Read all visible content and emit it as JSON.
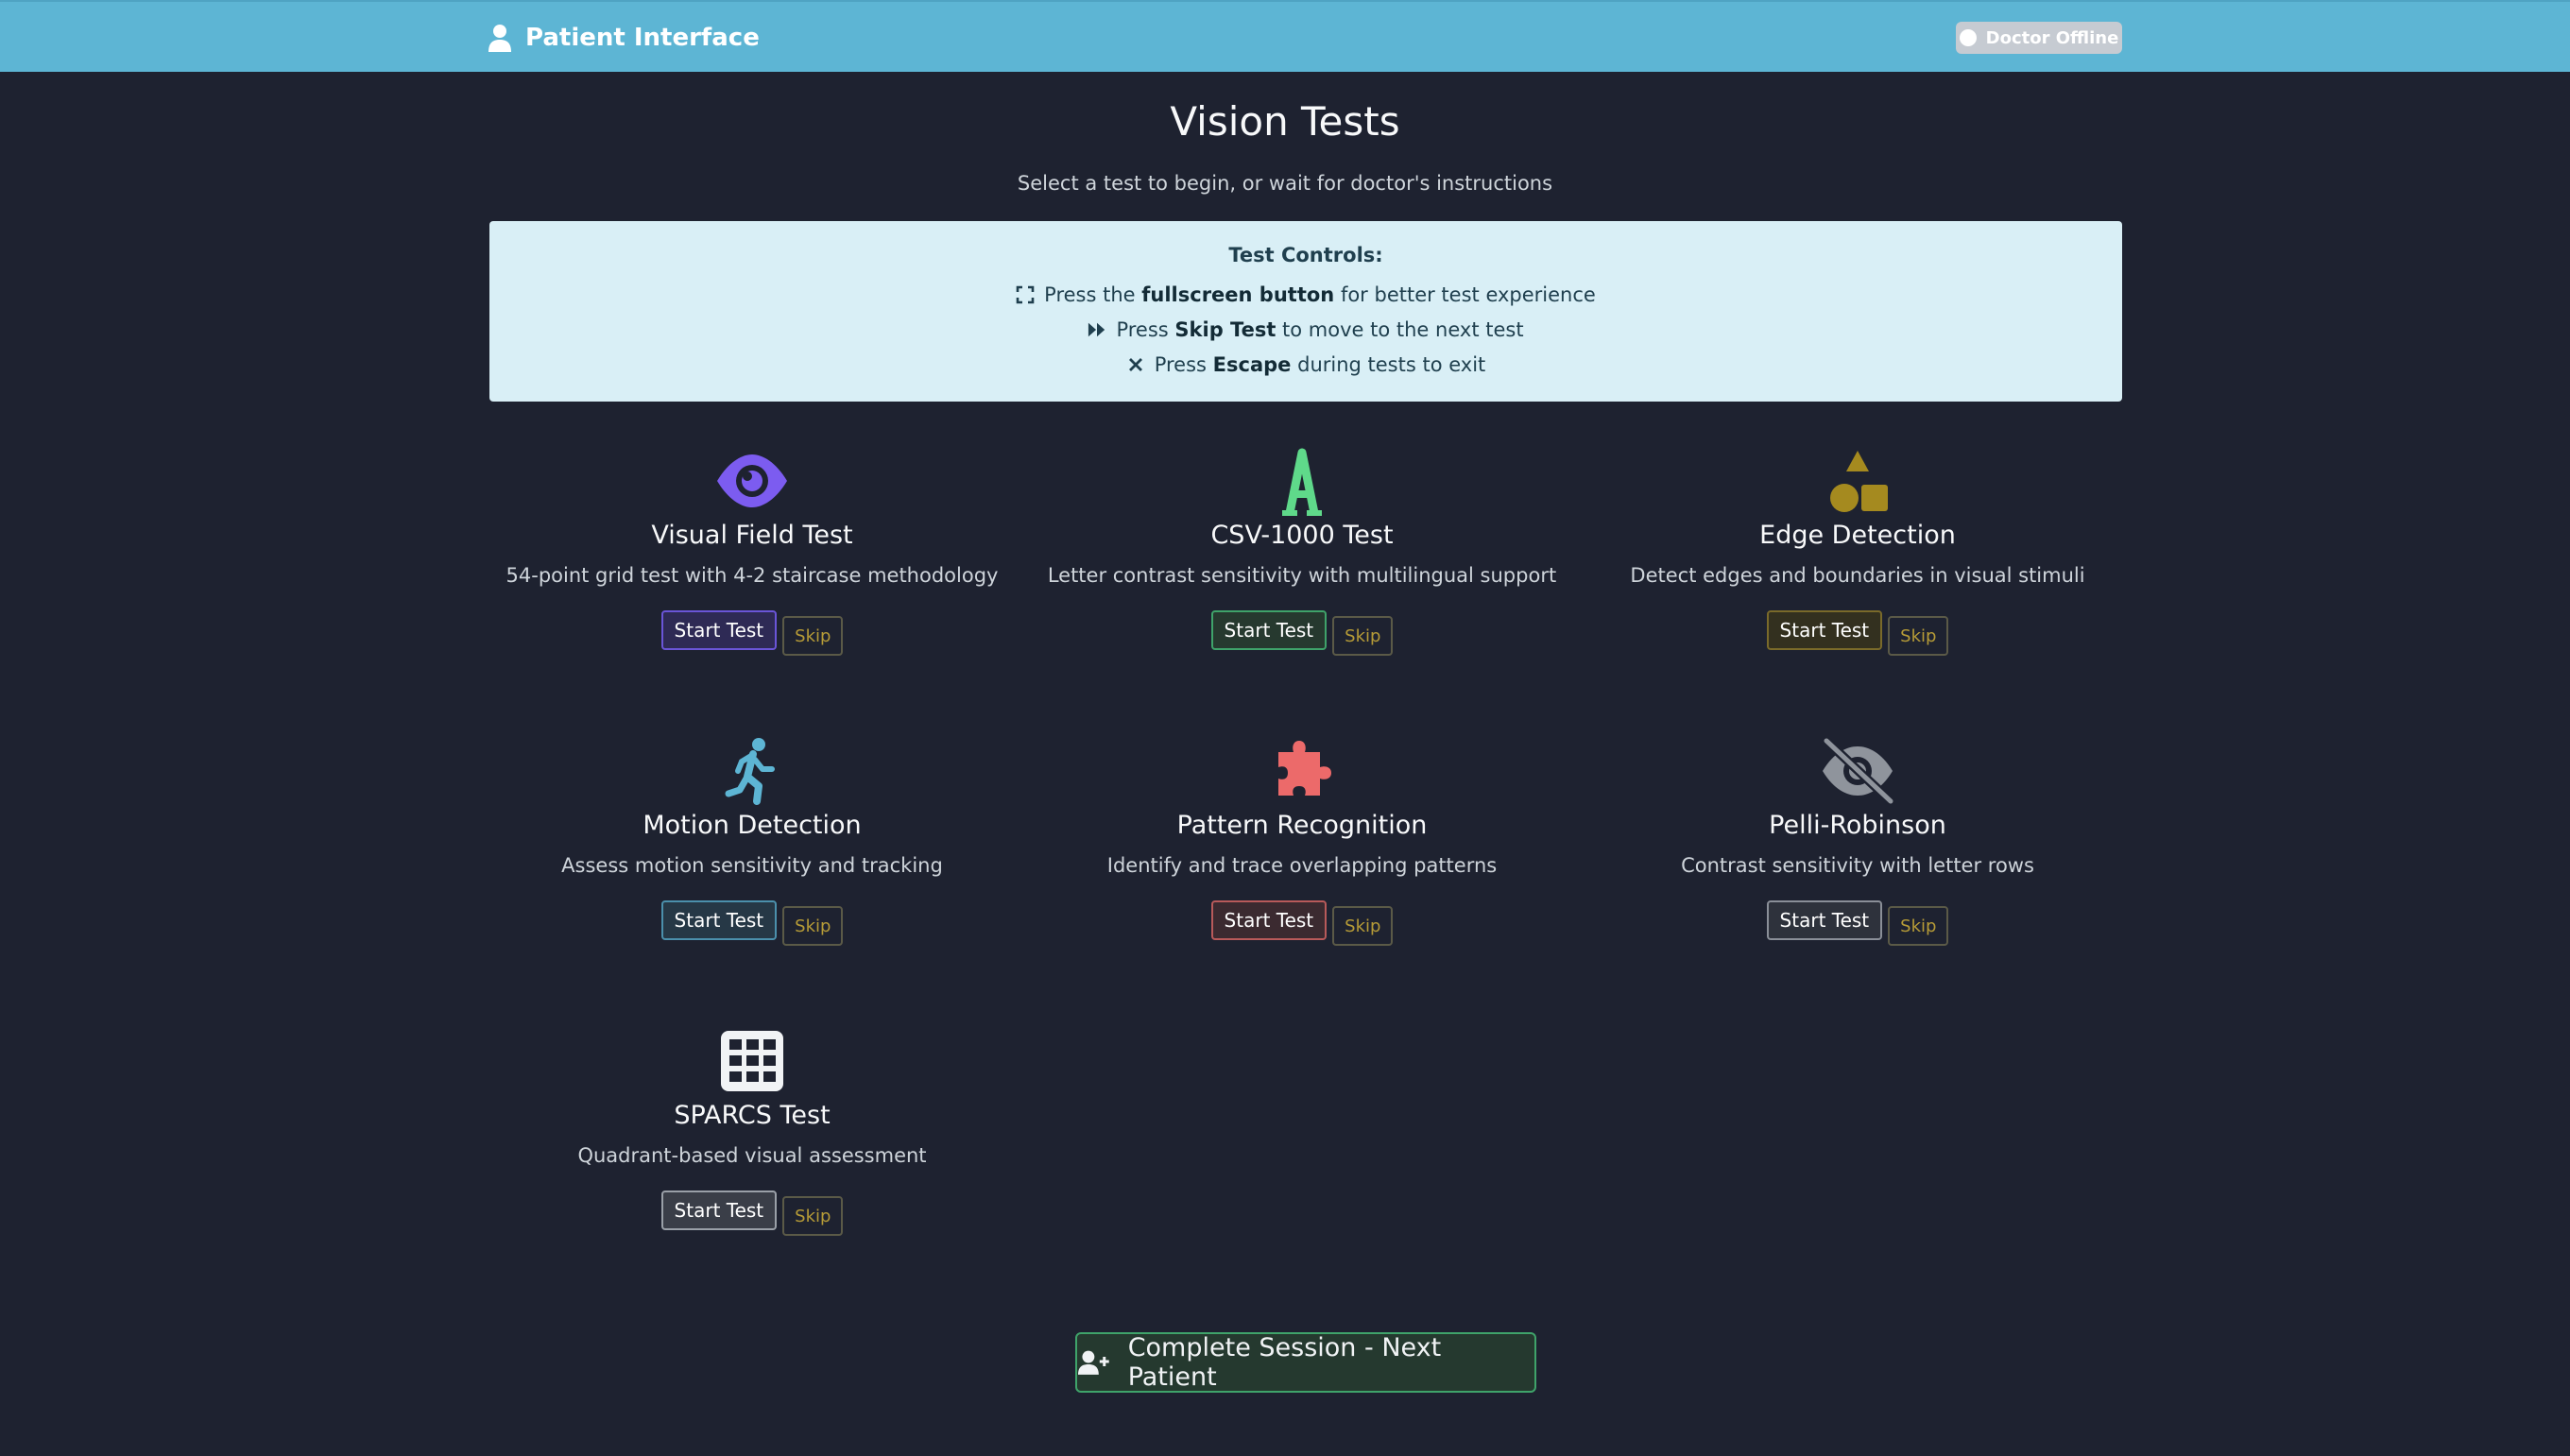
{
  "navbar": {
    "brand": "Patient Interface",
    "brand_icon": "user-icon",
    "status": "Doctor Offline"
  },
  "header": {
    "title": "Vision Tests",
    "subtitle": "Select a test to begin, or wait for doctor's instructions"
  },
  "controls": {
    "title": "Test Controls:",
    "lines": [
      {
        "icon": "expand-icon",
        "pre": "Press the",
        "bold": "fullscreen button",
        "post": "for better test experience"
      },
      {
        "icon": "fast-forward-icon",
        "pre": "Press",
        "bold": "Skip Test",
        "post": "to move to the next test"
      },
      {
        "icon": "close-icon",
        "pre": "Press",
        "bold": "Escape",
        "post": "during tests to exit"
      }
    ]
  },
  "tests": [
    {
      "title": "Visual Field Test",
      "desc": "54-point grid test with 4-2 staircase methodology",
      "start": "Start Test",
      "skip": "Skip",
      "icon": "eye-icon",
      "color": "#7c5cf0",
      "btn_bg": "#2e2a55",
      "btn_border": "#6a55d8"
    },
    {
      "title": "CSV-1000 Test",
      "desc": "Letter contrast sensitivity with multilingual support",
      "start": "Start Test",
      "skip": "Skip",
      "icon": "letter-a-icon",
      "color": "#5fd98a",
      "btn_bg": "#26392f",
      "btn_border": "#3fa36a"
    },
    {
      "title": "Edge Detection",
      "desc": "Detect edges and boundaries in visual stimuli",
      "start": "Start Test",
      "skip": "Skip",
      "icon": "shapes-icon",
      "color": "#a58a1f",
      "btn_bg": "#33301f",
      "btn_border": "#7a6a2a"
    },
    {
      "title": "Motion Detection",
      "desc": "Assess motion sensitivity and tracking",
      "start": "Start Test",
      "skip": "Skip",
      "icon": "running-person-icon",
      "color": "#5db5d4",
      "btn_bg": "#263846",
      "btn_border": "#4b90ac"
    },
    {
      "title": "Pattern Recognition",
      "desc": "Identify and trace overlapping patterns",
      "start": "Start Test",
      "skip": "Skip",
      "icon": "puzzle-icon",
      "color": "#ec6a6a",
      "btn_bg": "#3b2a30",
      "btn_border": "#b85a5a"
    },
    {
      "title": "Pelli-Robinson",
      "desc": "Contrast sensitivity with letter rows",
      "start": "Start Test",
      "skip": "Skip",
      "icon": "eye-slash-icon",
      "color": "#8f949c",
      "btn_bg": "#2e323c",
      "btn_border": "#8a8f98"
    },
    {
      "title": "SPARCS Test",
      "desc": "Quadrant-based visual assessment",
      "start": "Start Test",
      "skip": "Skip",
      "icon": "grid-icon",
      "color": "#f1f3f5",
      "btn_bg": "#3a3e48",
      "btn_border": "#9aa0a8"
    }
  ],
  "footer": {
    "complete": "Complete Session - Next Patient",
    "complete_icon": "user-plus-icon"
  }
}
